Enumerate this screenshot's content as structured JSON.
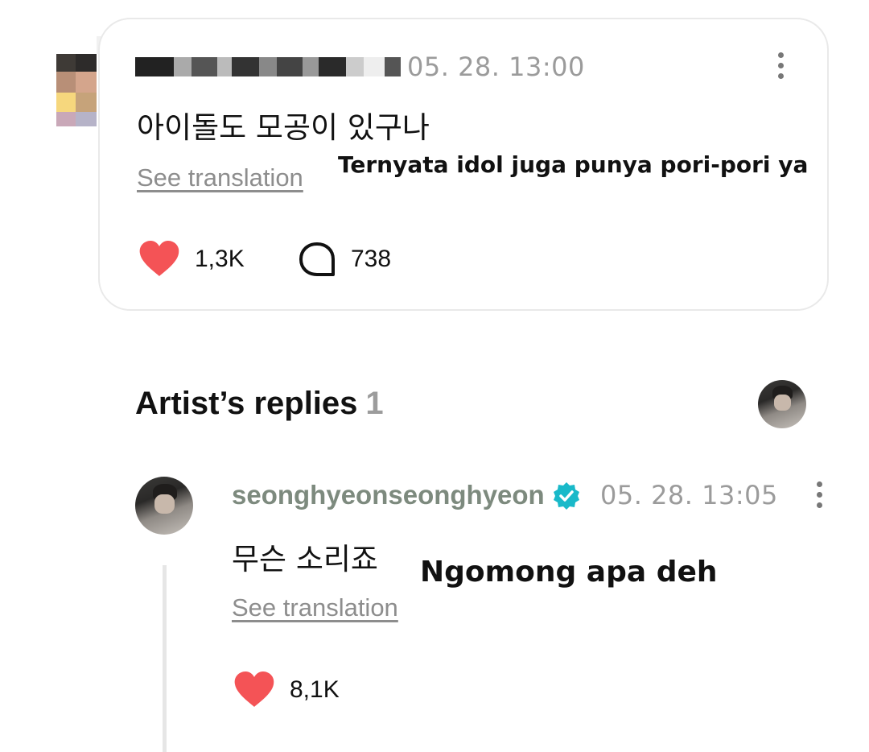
{
  "post": {
    "username_blurred": "",
    "timestamp": "05. 28. 13:00",
    "text": "아이돌도 모공이 있구나",
    "see_translation": "See translation",
    "overlay_translation": "Ternyata idol juga punya pori-pori ya",
    "likes": "1,3K",
    "comments": "738"
  },
  "artist_replies": {
    "title": "Artist’s replies",
    "count": "1"
  },
  "reply": {
    "username": "seonghyeonseonghyeon",
    "timestamp": "05. 28. 13:05",
    "text": "무슨 소리죠",
    "overlay_translation": "Ngomong apa deh",
    "see_translation": "See translation",
    "likes": "8,1K"
  },
  "icons": {
    "like": "heart-icon",
    "comment": "speech-bubble-icon",
    "more": "kebab-menu-icon",
    "verified": "verified-badge-icon"
  },
  "colors": {
    "heart": "#f45356",
    "verified": "#19b9c9",
    "artist_name": "#7d8a7e",
    "muted": "#9b9b9b"
  }
}
